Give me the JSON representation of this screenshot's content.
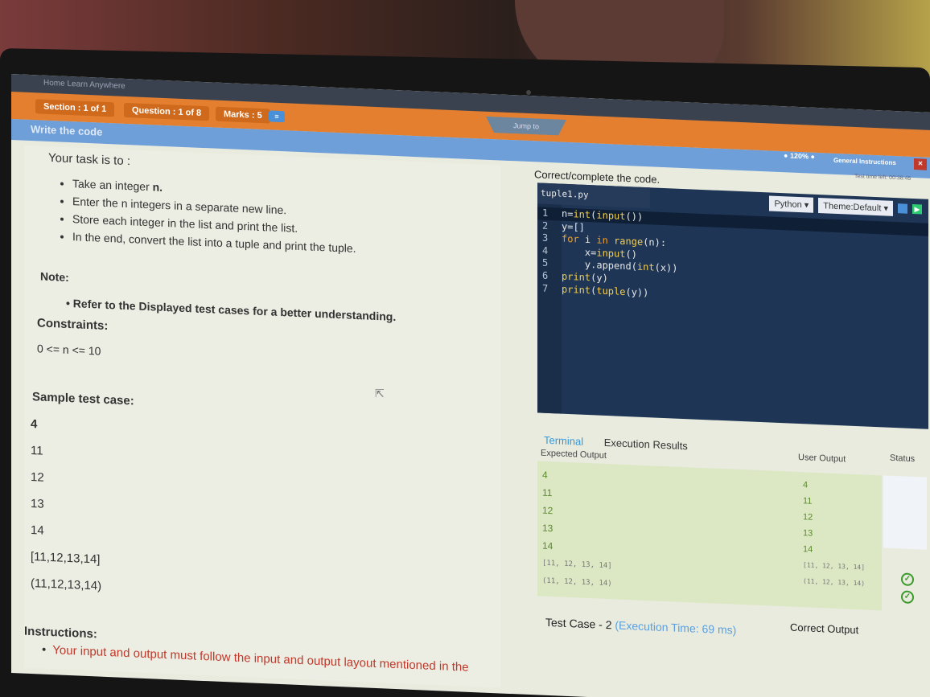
{
  "header": {
    "nav": "Home    Learn Anywhere",
    "section": "Section : 1 of 1",
    "question": "Question : 1 of 8",
    "marks": "Marks : 5",
    "jump": "Jump to",
    "write_code": "Write the code",
    "zoom": "120%",
    "general_instructions": "General Instructions",
    "close": "×",
    "timer": "Test time left: 00:38:45"
  },
  "problem": {
    "task_intro": "Your task is to :",
    "bullets": [
      {
        "pre": "Take an integer ",
        "bold": "n."
      },
      {
        "pre": "Enter the n integers in a separate new line.",
        "bold": ""
      },
      {
        "pre": "Store each integer in the list and print the list.",
        "bold": ""
      },
      {
        "pre": "In the end, convert the list into a tuple and print the tuple.",
        "bold": ""
      }
    ],
    "note_label": "Note:",
    "note_item": "Refer to the Displayed test cases for a better understanding.",
    "constraints_label": "Constraints:",
    "constraints_value": "0 <= n <= 10",
    "sample_label": "Sample test case:",
    "sample_lines": [
      "4",
      "11",
      "12",
      "13",
      "14",
      "[11,12,13,14]",
      "(11,12,13,14)"
    ],
    "instructions_label": "Instructions:",
    "instructions_item": "Your input and output must follow the input and output layout mentioned in the"
  },
  "editor": {
    "title": "Correct/complete the code.",
    "filename": "tuple1.py",
    "language": "Python",
    "theme": "Theme:Default",
    "run_icon": "play-icon",
    "lines": [
      {
        "n": "1",
        "text": "n=int(input())"
      },
      {
        "n": "2",
        "text": "y=[]"
      },
      {
        "n": "3",
        "text": "for i in range(n):"
      },
      {
        "n": "4",
        "text": "    x=input()"
      },
      {
        "n": "5",
        "text": "    y.append(int(x))"
      },
      {
        "n": "6",
        "text": "print(y)"
      },
      {
        "n": "7",
        "text": "print(tuple(y))"
      }
    ]
  },
  "results": {
    "tab_terminal": "Terminal",
    "tab_execution": "Execution Results",
    "expected_header": "Expected Output",
    "user_header": "User Output",
    "status_header": "Status",
    "expected": [
      "4",
      "11",
      "12",
      "13",
      "14"
    ],
    "expected_list": "[11, 12, 13, 14]",
    "expected_tuple": "(11, 12, 13, 14)",
    "user": [
      "4",
      "11",
      "12",
      "13",
      "14"
    ],
    "user_list": "[11, 12, 13, 14]",
    "user_tuple": "(11, 12, 13, 14)",
    "test_case": "Test Case - 2",
    "exec_time": "(Execution Time: 69 ms)",
    "correct_output": "Correct Output",
    "status_icon": "check-circle-icon",
    "status_color": "#3c9a2c"
  }
}
